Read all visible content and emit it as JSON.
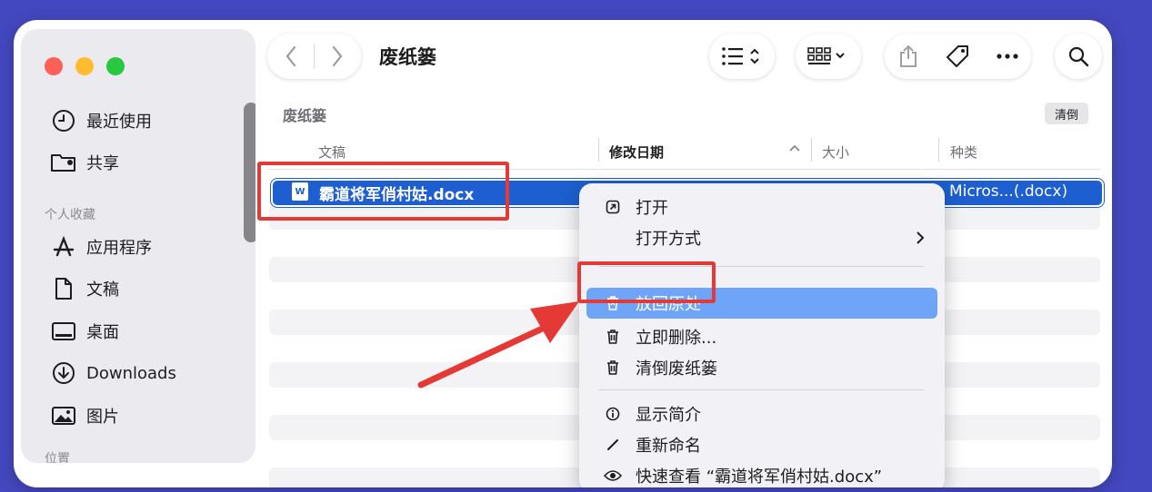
{
  "toolbar": {
    "title": "废纸篓"
  },
  "sidebar": {
    "items": [
      {
        "label": "最近使用",
        "icon": "clock-icon"
      },
      {
        "label": "共享",
        "icon": "shared-folder-icon"
      }
    ],
    "favorites_heading": "个人收藏",
    "favorites": [
      {
        "label": "应用程序",
        "icon": "applications-icon"
      },
      {
        "label": "文稿",
        "icon": "document-icon"
      },
      {
        "label": "桌面",
        "icon": "desktop-icon"
      },
      {
        "label": "Downloads",
        "icon": "download-icon"
      },
      {
        "label": "图片",
        "icon": "photo-icon"
      }
    ],
    "locations_heading": "位置"
  },
  "content": {
    "section_title": "废纸篓",
    "empty_button": "清倒",
    "columns": {
      "name": "文稿",
      "date": "修改日期",
      "size": "大小",
      "kind": "种类"
    },
    "files": [
      {
        "name": "霸道将军俏村姑.docx",
        "kind": "Micros...(.docx)",
        "selected": true
      }
    ]
  },
  "context_menu": {
    "items": [
      {
        "label": "打开",
        "icon": "open-icon"
      },
      {
        "label": "打开方式",
        "icon": "",
        "submenu": true
      },
      {
        "label": "放回原处",
        "icon": "put-back-icon",
        "highlighted": true
      },
      {
        "label": "立即删除...",
        "icon": "trash-icon"
      },
      {
        "label": "清倒废纸篓",
        "icon": "trash-icon"
      },
      {
        "label": "显示简介",
        "icon": "info-icon"
      },
      {
        "label": "重新命名",
        "icon": "pencil-icon"
      },
      {
        "label": "快速查看 “霸道将军俏村姑.docx”",
        "icon": "eye-icon"
      }
    ]
  },
  "colors": {
    "background": "#4448c0",
    "selection": "#1d5fd0",
    "menu_highlight": "#6ea5f8",
    "annotation_red": "#e53935"
  }
}
